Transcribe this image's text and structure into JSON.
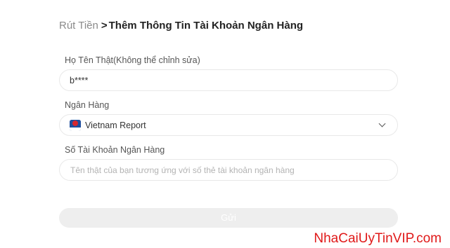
{
  "breadcrumb": {
    "parent": "Rút Tiền",
    "separator": ">",
    "current": "Thêm Thông Tin Tài Khoản Ngân Hàng"
  },
  "form": {
    "name_label": "Họ Tên Thật(Không thể chỉnh sửa)",
    "name_value": "b****",
    "bank_label": "Ngân Hàng",
    "bank_selected": "Vietnam Report",
    "bank_icon": "bank-logo-icon",
    "account_label": "Số Tài Khoản Ngân Hàng",
    "account_placeholder": "Tên thật của bạn tương ứng với số thẻ tài khoản ngân hàng",
    "account_value": "",
    "submit_label": "Gửi"
  },
  "watermark": "NhaCaiUyTinVIP.com",
  "colors": {
    "watermark": "#e01919",
    "bank_logo_blue": "#1f4e9e",
    "bank_logo_red": "#d8262e",
    "submit_disabled_bg": "#eeeeee"
  }
}
